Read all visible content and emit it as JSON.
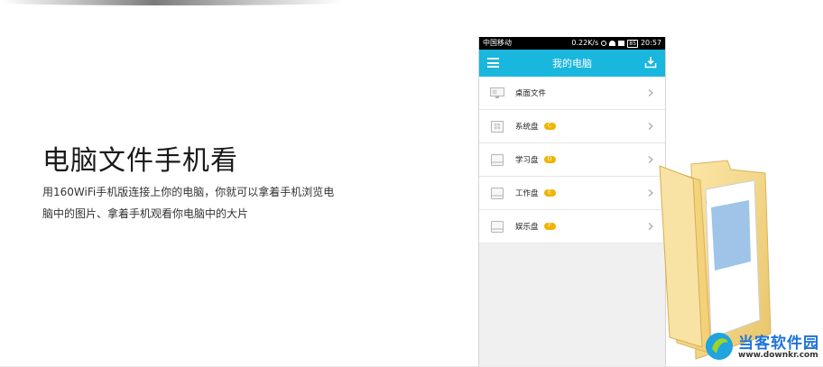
{
  "promo": {
    "headline": "电脑文件手机看",
    "description": "用160WiFi手机版连接上你的电脑，你就可以拿着手机浏览电脑中的图片、拿着手机观看你电脑中的大片"
  },
  "phone": {
    "status_bar": {
      "carrier": "中国移动",
      "speed": "0.22K/s",
      "battery": "85",
      "time": "20:57"
    },
    "app_bar": {
      "title": "我的电脑",
      "color": "#19b6dd"
    },
    "items": [
      {
        "label": "桌面文件",
        "badge": "",
        "icon": "monitor-icon"
      },
      {
        "label": "系统盘",
        "badge": "C",
        "icon": "windows-drive-icon"
      },
      {
        "label": "学习盘",
        "badge": "D",
        "icon": "drive-icon"
      },
      {
        "label": "工作盘",
        "badge": "E",
        "icon": "drive-icon"
      },
      {
        "label": "娱乐盘",
        "badge": "F",
        "icon": "drive-icon"
      }
    ],
    "badge_color": "#f0b400"
  },
  "watermark": {
    "title": "当客软件园",
    "url": "www.downkr.com"
  }
}
